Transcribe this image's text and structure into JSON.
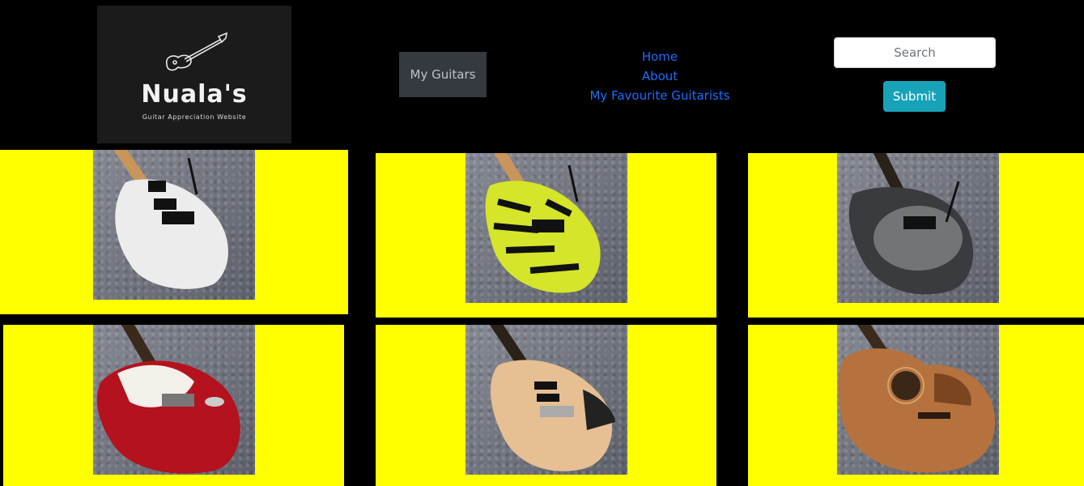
{
  "logo": {
    "title": "Nuala's",
    "subtitle": "Guitar Appreciation Website"
  },
  "my_guitars_button": "My Guitars",
  "nav": {
    "links": [
      "Home",
      "About",
      "My Favourite Guitarists"
    ]
  },
  "search": {
    "placeholder": "Search",
    "submit_label": "Submit"
  },
  "gallery": {
    "tile_color": "#ffff00",
    "guitars": [
      {
        "name": "white-guitar",
        "body_color": "#eeeeee"
      },
      {
        "name": "yellow-tiger-guitar",
        "body_color": "#d4e52a"
      },
      {
        "name": "black-burst-guitar",
        "body_color": "#3a3b3e"
      },
      {
        "name": "red-guitar",
        "body_color": "#b3121e"
      },
      {
        "name": "natural-wood-guitar",
        "body_color": "#e6bf93"
      },
      {
        "name": "acoustic-guitar",
        "body_color": "#b5723e"
      }
    ]
  }
}
